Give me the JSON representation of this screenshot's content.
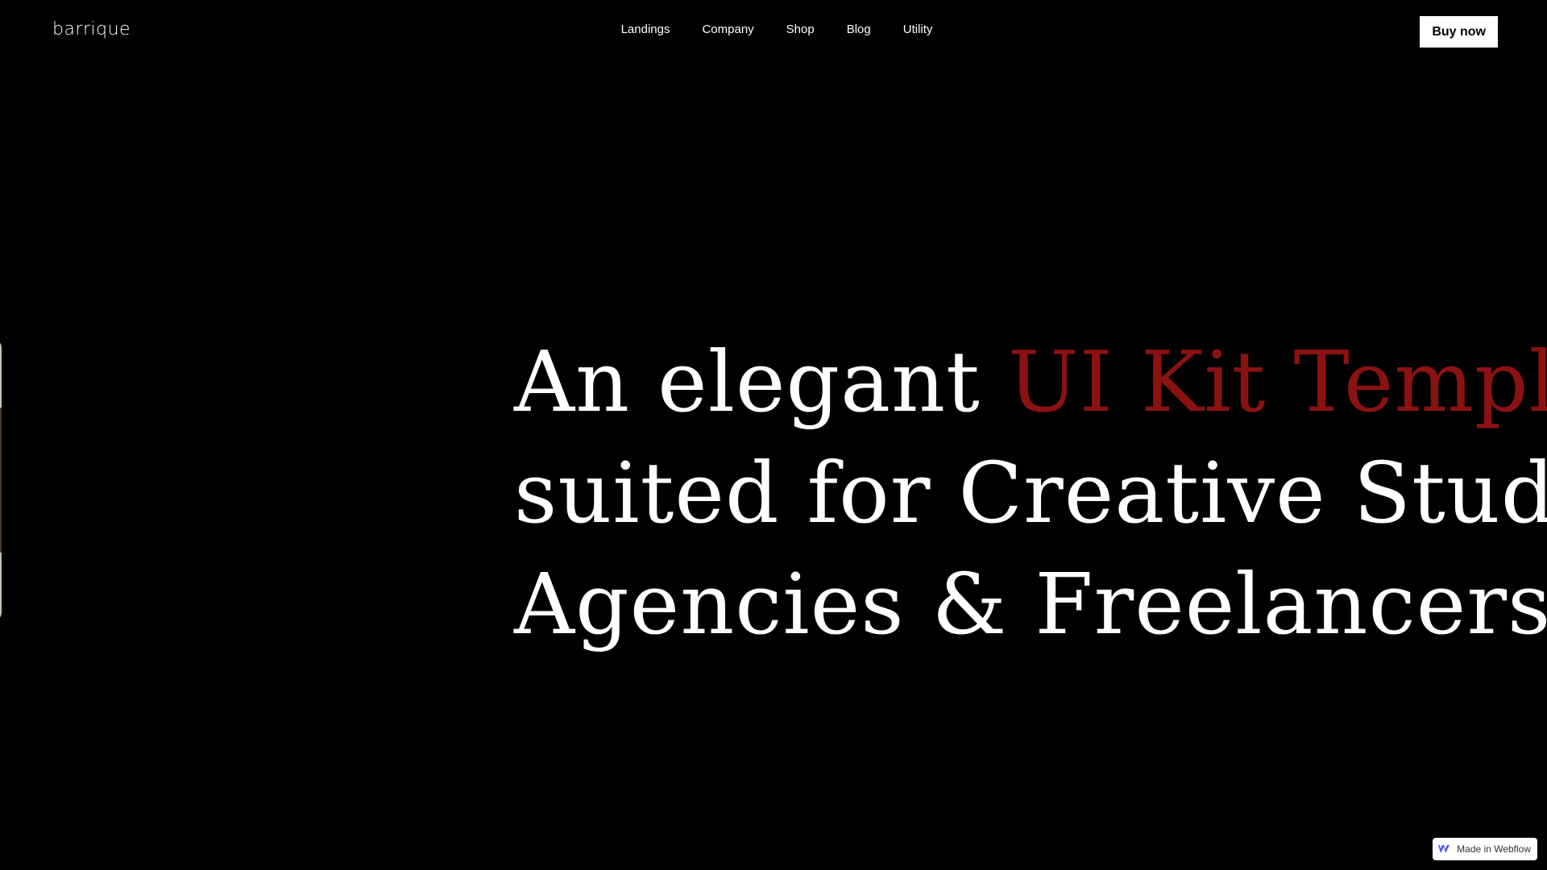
{
  "header": {
    "logo": "barrique",
    "nav": [
      "Landings",
      "Company",
      "Shop",
      "Blog",
      "Utility"
    ],
    "buy_label": "Buy now"
  },
  "hero": {
    "line1_start": "An elegant ",
    "line1_accent": "UI Kit Template",
    "line2": "suited for Creative Studios,",
    "line3": "Agencies & Freelancers"
  },
  "badge": {
    "label": "Made in Webflow",
    "icon": "webflow-icon"
  },
  "colors": {
    "background": "#000000",
    "text": "#ffffff",
    "accent": "#8c1212",
    "button_bg": "#ffffff",
    "button_text": "#000000"
  }
}
